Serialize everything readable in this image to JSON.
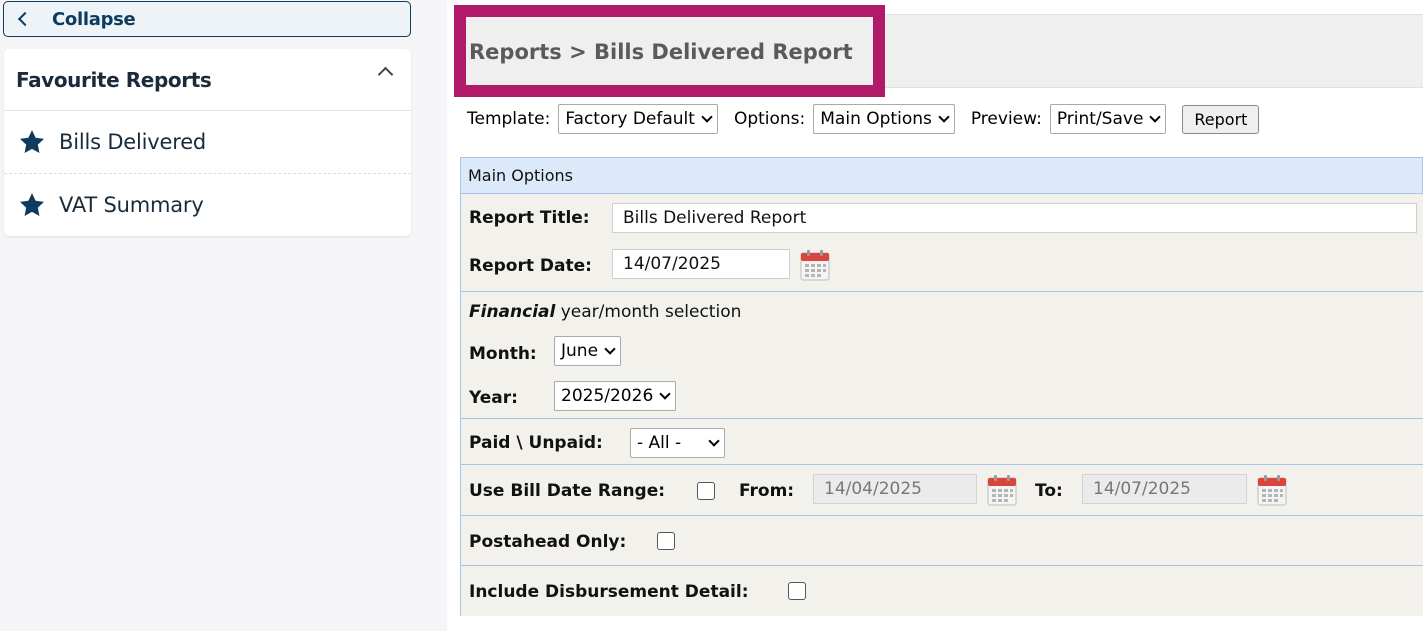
{
  "sidebar": {
    "collapse_label": "Collapse",
    "favourites_title": "Favourite Reports",
    "items": [
      {
        "label": "Bills Delivered"
      },
      {
        "label": "VAT Summary"
      }
    ]
  },
  "breadcrumb": "Reports > Bills Delivered Report",
  "toolbar": {
    "template_label": "Template:",
    "template_value": "Factory Default",
    "options_label": "Options:",
    "options_value": "Main Options",
    "preview_label": "Preview:",
    "preview_value": "Print/Save",
    "report_button": "Report"
  },
  "options_header": "Main Options",
  "form": {
    "report_title_label": "Report Title:",
    "report_title_value": "Bills Delivered Report",
    "report_date_label": "Report Date:",
    "report_date_value": "14/07/2025",
    "financial_word": "Financial",
    "financial_rest": "year/month selection",
    "month_label": "Month:",
    "month_value": "June",
    "year_label": "Year:",
    "year_value": "2025/2026",
    "paid_label": "Paid \\ Unpaid:",
    "paid_value": "- All -",
    "use_bill_range_label": "Use Bill Date Range:",
    "from_label": "From:",
    "from_value": "14/04/2025",
    "to_label": "To:",
    "to_value": "14/07/2025",
    "postahead_label": "Postahead Only:",
    "disbursement_label": "Include Disbursement Detail:"
  },
  "colors": {
    "highlight": "#b01a68",
    "sidebar_text": "#0d3b5e",
    "options_header_bg": "#dbe9fb",
    "form_bg": "#f3f1ec"
  }
}
